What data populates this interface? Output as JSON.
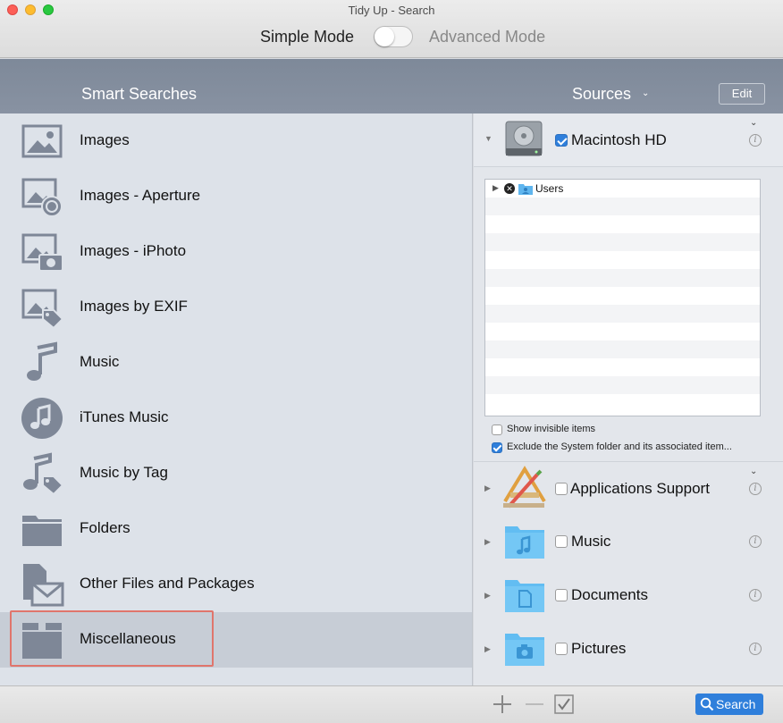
{
  "window": {
    "title": "Tidy Up - Search"
  },
  "mode": {
    "simple_label": "Simple Mode",
    "advanced_label": "Advanced Mode",
    "advanced_enabled": false
  },
  "header": {
    "smart_searches_label": "Smart Searches",
    "sources_label": "Sources",
    "edit_label": "Edit"
  },
  "smart_searches": [
    {
      "label": "Images",
      "icon": "image-icon"
    },
    {
      "label": "Images - Aperture",
      "icon": "image-aperture-icon"
    },
    {
      "label": "Images - iPhoto",
      "icon": "image-camera-icon"
    },
    {
      "label": "Images by EXIF",
      "icon": "image-tag-icon"
    },
    {
      "label": "Music",
      "icon": "music-note-icon"
    },
    {
      "label": "iTunes Music",
      "icon": "itunes-icon"
    },
    {
      "label": "Music by Tag",
      "icon": "music-tag-icon"
    },
    {
      "label": "Folders",
      "icon": "folder-icon"
    },
    {
      "label": "Other Files and Packages",
      "icon": "file-envelope-icon"
    },
    {
      "label": "Miscellaneous",
      "icon": "box-icon",
      "selected": true
    }
  ],
  "sources": {
    "primary": {
      "name": "Macintosh HD",
      "checked": true,
      "icon": "hard-drive-icon",
      "tree": [
        {
          "label": "Users",
          "icon": "users-folder-icon",
          "excluded": true
        }
      ],
      "options": [
        {
          "label": "Show invisible items",
          "checked": false
        },
        {
          "label": "Exclude the System folder and its associated item...",
          "checked": true
        }
      ]
    },
    "items": [
      {
        "name": "Applications Support",
        "checked": false,
        "icon": "applications-icon"
      },
      {
        "name": "Music",
        "checked": false,
        "icon": "music-folder-icon"
      },
      {
        "name": "Documents",
        "checked": false,
        "icon": "documents-folder-icon"
      },
      {
        "name": "Pictures",
        "checked": false,
        "icon": "pictures-folder-icon"
      }
    ]
  },
  "footer": {
    "search_label": "Search"
  },
  "colors": {
    "accent": "#2f7fdb",
    "header_band": "#848e9e",
    "selection_outline": "#e0756c"
  }
}
